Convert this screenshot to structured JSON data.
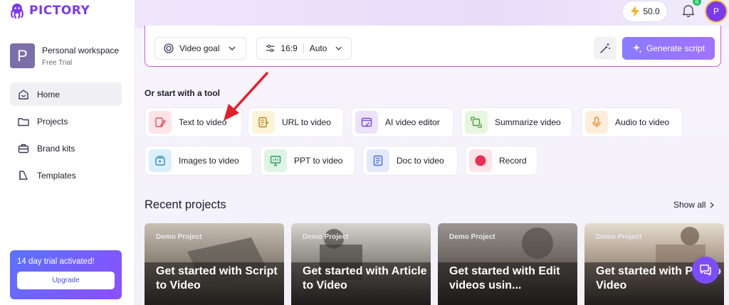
{
  "app": {
    "brand": "PICTORY"
  },
  "workspace": {
    "initial": "P",
    "name": "Personal workspace",
    "plan": "Free Trial"
  },
  "nav": [
    {
      "label": "Home",
      "icon": "home-icon"
    },
    {
      "label": "Projects",
      "icon": "folder-icon"
    },
    {
      "label": "Brand kits",
      "icon": "briefcase-icon"
    },
    {
      "label": "Templates",
      "icon": "template-icon"
    }
  ],
  "trial": {
    "text": "14 day trial activated!",
    "upgrade_label": "Upgrade"
  },
  "header": {
    "credits": "50.0",
    "notifications": "6",
    "user_initial": "P"
  },
  "prompt": {
    "goal_label": "Video goal",
    "ratio_label": "16:9",
    "duration_label": "Auto",
    "generate_label": "Generate script"
  },
  "tools": {
    "section_label": "Or start with a tool",
    "items": [
      {
        "label": "Text to video",
        "icon": "text-video-icon"
      },
      {
        "label": "URL to video",
        "icon": "url-video-icon"
      },
      {
        "label": "AI video editor",
        "icon": "ai-editor-icon"
      },
      {
        "label": "Summarize video",
        "icon": "summarize-icon"
      },
      {
        "label": "Audio to video",
        "icon": "microphone-icon"
      },
      {
        "label": "Images to video",
        "icon": "images-video-icon"
      },
      {
        "label": "PPT to video",
        "icon": "ppt-icon"
      },
      {
        "label": "Doc to video",
        "icon": "doc-icon"
      },
      {
        "label": "Record",
        "icon": "record-icon"
      }
    ]
  },
  "recent": {
    "title": "Recent projects",
    "show_all": "Show all",
    "cards": [
      {
        "tag": "Demo Project",
        "title": "Get started with Script to Video"
      },
      {
        "tag": "Demo Project",
        "title": "Get started with Article to Video"
      },
      {
        "tag": "Demo Project",
        "title": "Get started with Edit videos usin..."
      },
      {
        "tag": "Demo Project",
        "title": "Get started with PPT to Video"
      }
    ]
  },
  "colors": {
    "accent": "#7c3aed",
    "highlight_border": "#d65ad1",
    "annotation_arrow": "#e5202a"
  }
}
